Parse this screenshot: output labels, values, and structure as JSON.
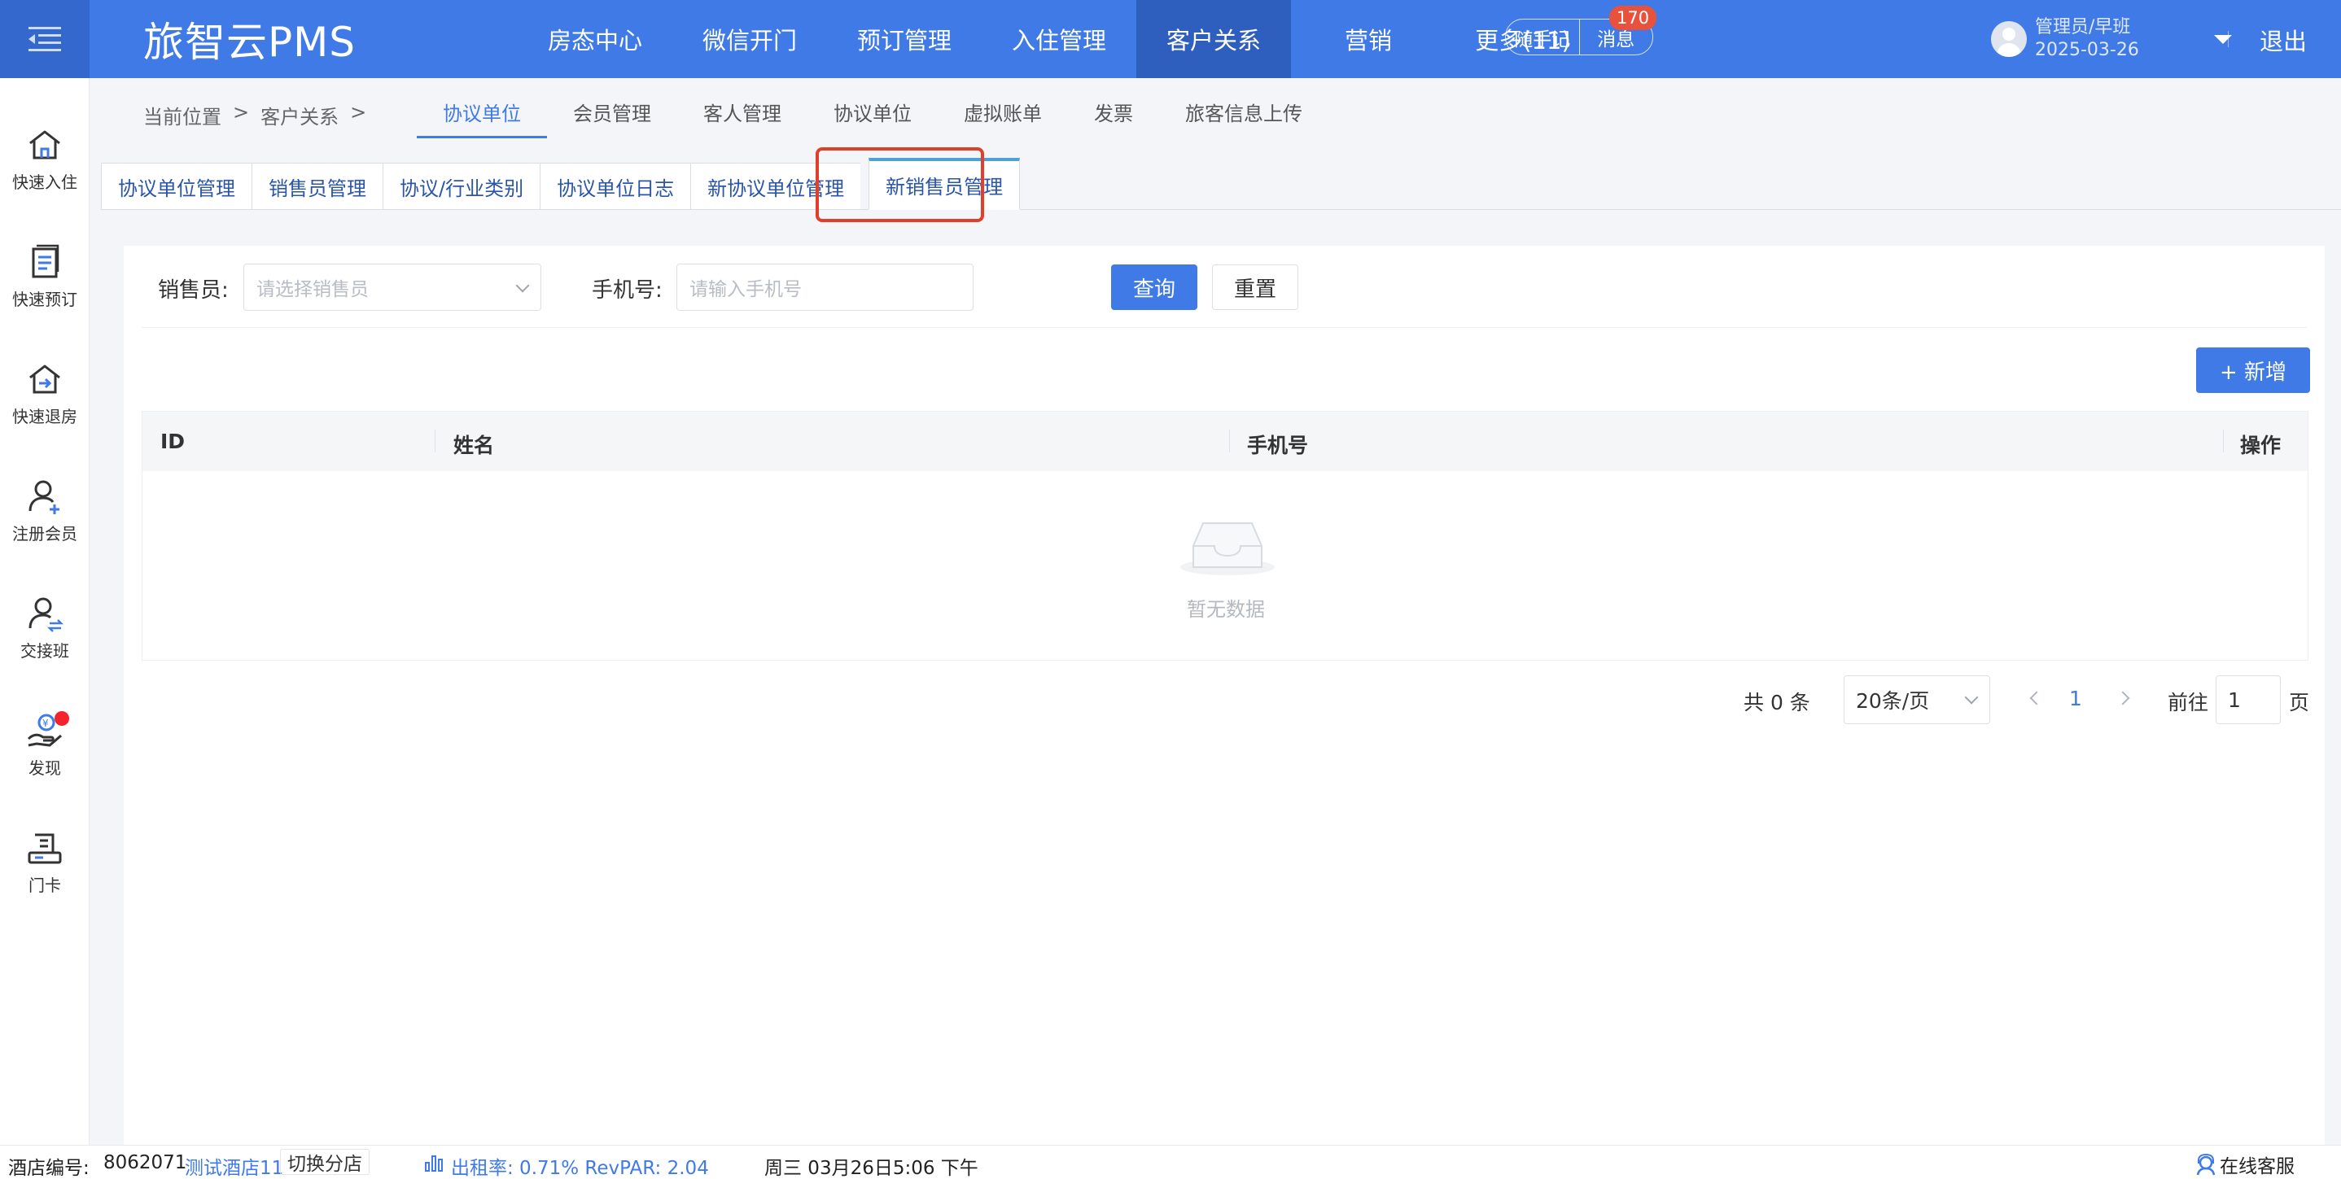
{
  "colors": {
    "primary": "#3f7ae6",
    "badge": "#e8523c",
    "highlight": "#e0402a",
    "tab_accent": "#4da1d7"
  },
  "header": {
    "logo": "旅智云PMS",
    "nav": [
      "房态中心",
      "微信开门",
      "预订管理",
      "入住管理",
      "客户关系",
      "营销",
      "更多(11)"
    ],
    "active_nav": "客户关系",
    "memo": "随手记",
    "messages": "消息",
    "message_count": "170",
    "user_role": "管理员/早班",
    "user_date": "2025-03-26",
    "logout": "退出"
  },
  "sidebar": {
    "items": [
      {
        "label": "快速入住",
        "icon": "home-icon"
      },
      {
        "label": "快速预订",
        "icon": "booking-list-icon"
      },
      {
        "label": "快速退房",
        "icon": "checkout-home-icon"
      },
      {
        "label": "注册会员",
        "icon": "add-member-icon"
      },
      {
        "label": "交接班",
        "icon": "shift-swap-icon"
      },
      {
        "label": "发现",
        "icon": "discover-money-icon"
      },
      {
        "label": "门卡",
        "icon": "door-card-icon"
      }
    ]
  },
  "breadcrumb": {
    "prefix": "当前位置",
    "sep": ">",
    "section": "客户关系",
    "sep2": ">"
  },
  "subnav": [
    "协议单位",
    "会员管理",
    "客人管理",
    "协议单位",
    "虚拟账单",
    "发票",
    "旅客信息上传"
  ],
  "tabs": [
    "协议单位管理",
    "销售员管理",
    "协议/行业类别",
    "协议单位日志",
    "新协议单位管理",
    "新销售员管理"
  ],
  "filters": {
    "salesperson_label": "销售员:",
    "salesperson_placeholder": "请选择销售员",
    "phone_label": "手机号:",
    "phone_placeholder": "请输入手机号",
    "query_button": "查询",
    "reset_button": "重置"
  },
  "add_button": "+ 新增",
  "table": {
    "columns": [
      "ID",
      "姓名",
      "手机号",
      "操作"
    ],
    "rows": [],
    "empty_text": "暂无数据"
  },
  "pagination": {
    "total": "共 0 条",
    "page_size": "20条/页",
    "current_page": "1",
    "goto_label": "前往",
    "goto_value": "1",
    "page_suffix": "页"
  },
  "statusbar": {
    "hotel_code_label": "酒店编号:",
    "hotel_code": "8062071",
    "hotel_name": "测试酒店11",
    "switch_store": "切换分店",
    "occupancy": "出租率: 0.71% RevPAR: 2.04",
    "datetime": "周三 03月26日5:06 下午",
    "online_service": "在线客服"
  }
}
